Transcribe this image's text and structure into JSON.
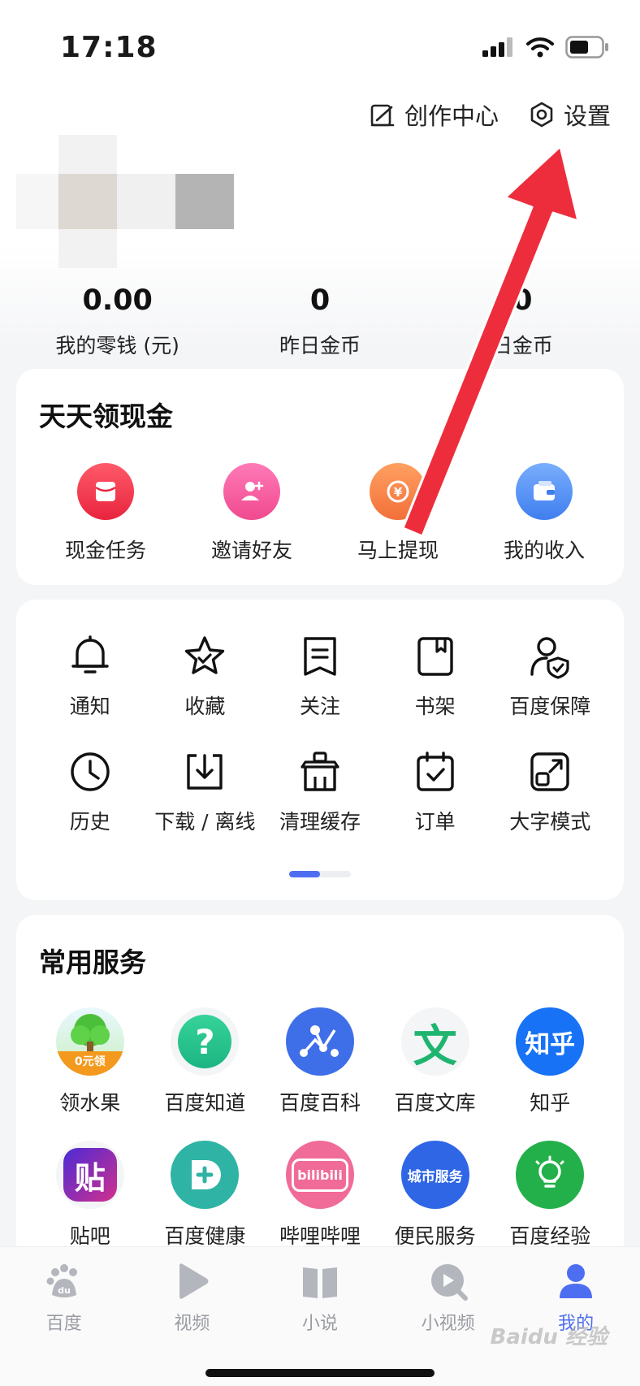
{
  "status_bar": {
    "time": "17:18"
  },
  "top_actions": {
    "creator_center": "创作中心",
    "settings": "设置"
  },
  "stats": [
    {
      "value": "0.00",
      "label": "我的零钱 (元)"
    },
    {
      "value": "0",
      "label": "昨日金币"
    },
    {
      "value": "0",
      "label": "日金币"
    }
  ],
  "cash_section": {
    "title": "天天领现金",
    "items": [
      {
        "label": "现金任务",
        "icon": "red-envelope-icon",
        "color": "#f0384f"
      },
      {
        "label": "邀请好友",
        "icon": "invite-user-icon",
        "color": "#f5559a"
      },
      {
        "label": "马上提现",
        "icon": "withdraw-coin-icon",
        "color": "#ff7a3d"
      },
      {
        "label": "我的收入",
        "icon": "wallet-icon",
        "color": "#4e8ef7"
      }
    ]
  },
  "tools": {
    "items": [
      {
        "label": "通知",
        "icon": "bell-icon"
      },
      {
        "label": "收藏",
        "icon": "star-icon"
      },
      {
        "label": "关注",
        "icon": "bookmark-icon"
      },
      {
        "label": "书架",
        "icon": "book-icon"
      },
      {
        "label": "百度保障",
        "icon": "shield-user-icon"
      },
      {
        "label": "历史",
        "icon": "clock-icon"
      },
      {
        "label": "下载 / 离线",
        "icon": "download-icon"
      },
      {
        "label": "清理缓存",
        "icon": "clean-bucket-icon"
      },
      {
        "label": "订单",
        "icon": "order-icon"
      },
      {
        "label": "大字模式",
        "icon": "expand-icon"
      }
    ]
  },
  "services": {
    "title": "常用服务",
    "items": [
      {
        "label": "领水果",
        "icon": "fruit-tree-icon",
        "badge": "0元领"
      },
      {
        "label": "百度知道",
        "icon": "question-icon",
        "glyph": "?"
      },
      {
        "label": "百度百科",
        "icon": "baike-icon"
      },
      {
        "label": "百度文库",
        "icon": "wenku-icon",
        "glyph": "文"
      },
      {
        "label": "知乎",
        "icon": "zhihu-icon",
        "glyph": "知乎"
      },
      {
        "label": "贴吧",
        "icon": "tieba-icon",
        "glyph": "贴"
      },
      {
        "label": "百度健康",
        "icon": "health-icon"
      },
      {
        "label": "哔哩哔哩",
        "icon": "bilibili-icon",
        "glyph": "bilibili"
      },
      {
        "label": "便民服务",
        "icon": "city-service-icon",
        "glyph": "城市服务"
      },
      {
        "label": "百度经验",
        "icon": "experience-icon"
      }
    ]
  },
  "bottom_nav": {
    "items": [
      {
        "label": "百度",
        "icon": "baidu-paw-icon"
      },
      {
        "label": "视频",
        "icon": "video-play-icon"
      },
      {
        "label": "小说",
        "icon": "novel-book-icon"
      },
      {
        "label": "小视频",
        "icon": "short-video-icon"
      },
      {
        "label": "我的",
        "icon": "profile-icon",
        "active": true
      }
    ]
  },
  "watermark": "Baidu 经验",
  "colors": {
    "accent": "#4e6ef2",
    "arrow": "#ee2d3c"
  }
}
